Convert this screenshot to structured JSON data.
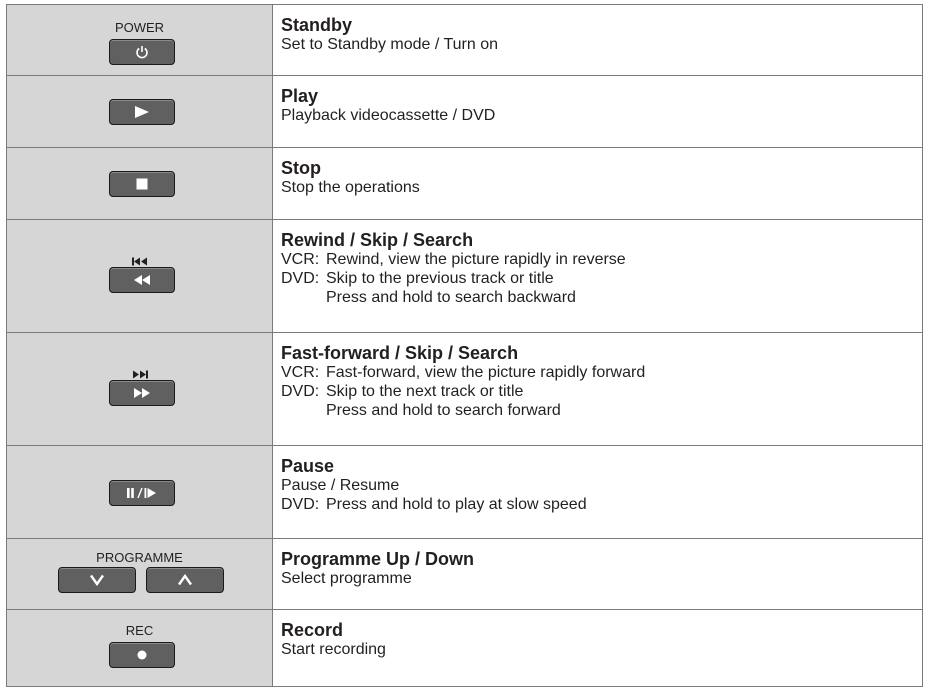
{
  "rows": [
    {
      "key_caption": "POWER",
      "key_icon": "power-icon",
      "title": "Standby",
      "lines": [
        "Set to Standby mode / Turn on"
      ]
    },
    {
      "key_icon": "play-icon",
      "title": "Play",
      "lines": [
        "Playback videocassette / DVD"
      ]
    },
    {
      "key_icon": "stop-icon",
      "title": "Stop",
      "lines": [
        "Stop the operations"
      ]
    },
    {
      "key_icon": "rewind-icon",
      "key_top_icon": "skip-previous-icon",
      "title": "Rewind / Skip / Search",
      "lines": [
        {
          "prefix": "VCR:",
          "text": "Rewind, view the picture rapidly in reverse"
        },
        {
          "prefix": "DVD:",
          "text": "Skip to the previous track or title"
        },
        {
          "text": "Press and hold to search backward"
        }
      ]
    },
    {
      "key_icon": "fast-forward-icon",
      "key_top_icon": "skip-next-icon",
      "title": "Fast-forward / Skip / Search",
      "lines": [
        {
          "prefix": "VCR:",
          "text": "Fast-forward, view the picture rapidly forward"
        },
        {
          "prefix": "DVD:",
          "text": "Skip to the next track or title"
        },
        {
          "text": "Press and hold to search forward"
        }
      ]
    },
    {
      "key_icon": "pause-slow-icon",
      "title": "Pause",
      "lines": [
        {
          "text": "Pause / Resume"
        },
        {
          "prefix": "DVD:",
          "text": "Press and hold to play at slow speed"
        }
      ]
    },
    {
      "key_caption": "PROGRAMME",
      "key_icon": "chevron-down-icon",
      "key_icon_2": "chevron-up-icon",
      "title": "Programme Up / Down",
      "lines": [
        "Select programme"
      ]
    },
    {
      "key_caption": "REC",
      "key_icon": "record-icon",
      "title": "Record",
      "lines": [
        "Start recording"
      ]
    }
  ],
  "colors": {
    "key_fill": "#606060",
    "button_column_bg": "#d6d6d6",
    "border": "#7a7a7a"
  }
}
